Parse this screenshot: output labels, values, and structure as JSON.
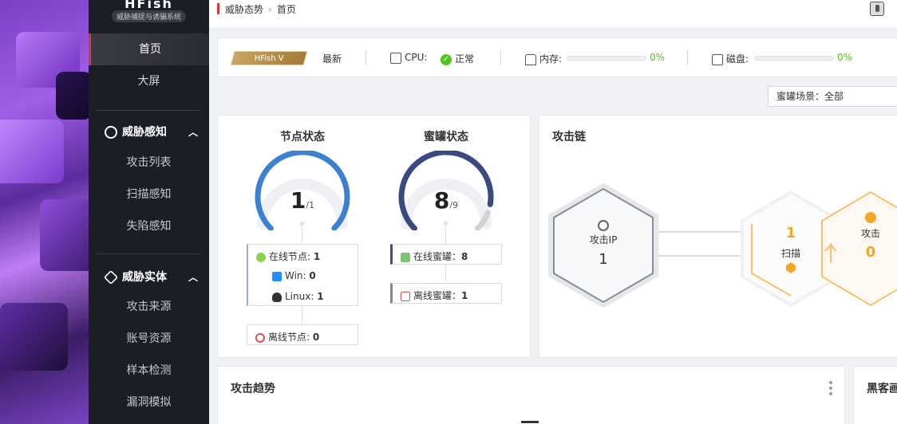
{
  "brand": {
    "name": "HFish",
    "subtitle": "威胁捕捉与诱骗系统"
  },
  "sidebar": {
    "top_items": [
      {
        "label": "首页",
        "active": true
      },
      {
        "label": "大屏",
        "active": false
      }
    ],
    "groups": [
      {
        "title": "威胁感知",
        "icon": "radar-icon",
        "items": [
          "攻击列表",
          "扫描感知",
          "失陷感知"
        ]
      },
      {
        "title": "威胁实体",
        "icon": "cube-icon",
        "items": [
          "攻击来源",
          "账号资源",
          "样本检测",
          "漏洞模拟"
        ]
      }
    ]
  },
  "breadcrumb": {
    "parent": "威胁态势",
    "current": "首页"
  },
  "status": {
    "version_badge": "HFish V",
    "version_state": "最新",
    "cpu_label": "CPU:",
    "cpu_state": "正常",
    "memory_label": "内存:",
    "memory_pct": "0%",
    "disk_label": "磁盘:",
    "disk_pct": "0%",
    "ok_color": "#52c41a"
  },
  "scene_select": {
    "label": "蜜罐场景：全部"
  },
  "node_status": {
    "title": "节点状态",
    "value": "1",
    "total": "/1",
    "fraction": 1.0,
    "color": "#3d7fd1",
    "online_label": "在线节点:",
    "online_value": "1",
    "win_label": "Win:",
    "win_value": "0",
    "linux_label": "Linux:",
    "linux_value": "1",
    "offline_label": "离线节点:",
    "offline_value": "0"
  },
  "honeypot_status": {
    "title": "蜜罐状态",
    "value": "8",
    "total": "/9",
    "fraction": 0.889,
    "color": "#3a4a80",
    "online_label": "在线蜜罐：",
    "online_value": "8",
    "offline_label": "离线蜜罐：",
    "offline_value": "1"
  },
  "attack_chain": {
    "title": "攻击链",
    "ip_label": "攻击IP",
    "ip_value": "1",
    "scan_label": "扫描",
    "scan_value": "1",
    "attack_label": "攻击",
    "attack_value": "0",
    "accent_color": "#f5a623"
  },
  "attack_trend": {
    "title": "攻击趋势"
  },
  "hacker_profile": {
    "title": "黑客画"
  }
}
